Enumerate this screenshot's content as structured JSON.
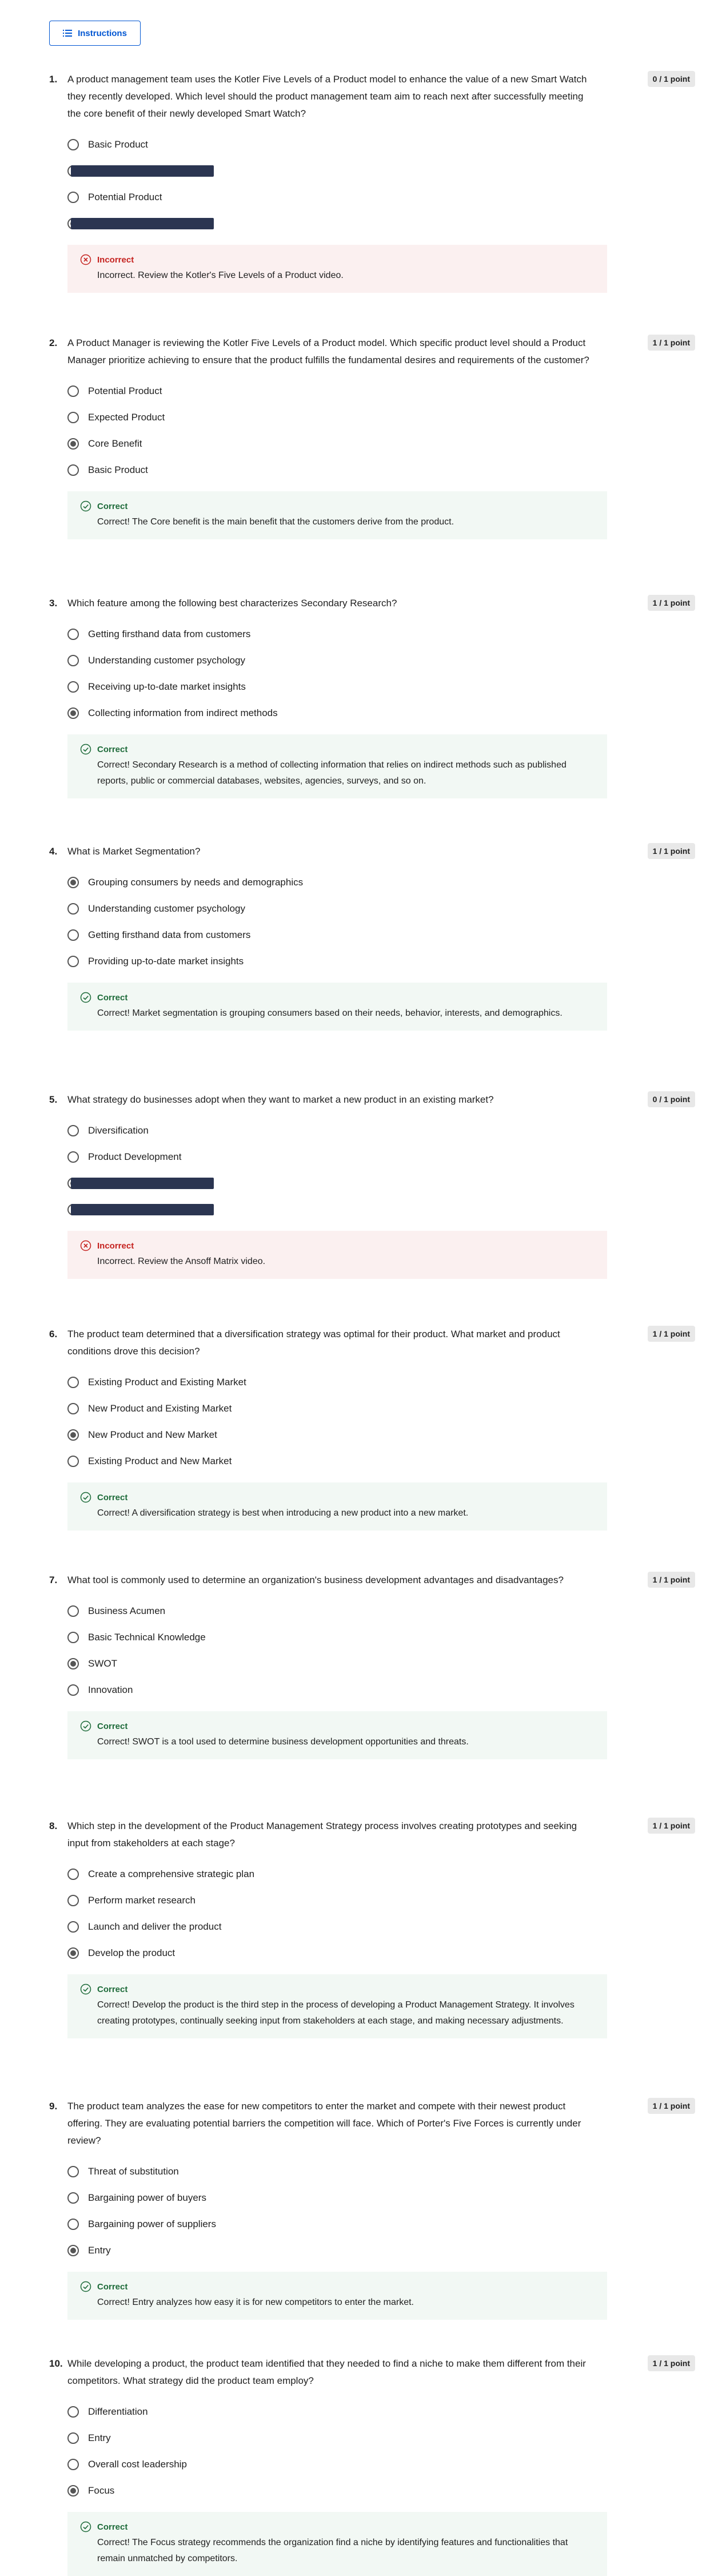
{
  "instructions_label": "Instructions",
  "colors": {
    "accent": "#0056d2",
    "correct": "#1e6b3a",
    "incorrect": "#c5221f"
  },
  "questions": [
    {
      "number": "1.",
      "text": "A product management team uses the Kotler Five Levels of a Product model to enhance the value of a new Smart Watch they recently developed. Which level should the product management team aim to reach next after successfully meeting the core benefit of their newly developed Smart Watch?",
      "score": "0 / 1 point",
      "options": [
        {
          "label": "Basic Product",
          "checked": false
        },
        {
          "label": "",
          "checked": false,
          "redacted": true
        },
        {
          "label": "Potential Product",
          "checked": false
        },
        {
          "label": "",
          "checked": true,
          "redacted": true
        }
      ],
      "feedback": {
        "status": "Incorrect",
        "text": "Incorrect. Review the Kotler's Five Levels of a Product video."
      }
    },
    {
      "number": "2.",
      "text": "A Product Manager is reviewing the Kotler Five Levels of a Product model. Which specific product level should a Product Manager prioritize achieving to ensure that the product fulfills the fundamental desires and requirements of the customer?",
      "score": "1 / 1 point",
      "options": [
        {
          "label": "Potential Product",
          "checked": false
        },
        {
          "label": "Expected Product",
          "checked": false
        },
        {
          "label": "Core Benefit",
          "checked": true
        },
        {
          "label": "Basic Product",
          "checked": false
        }
      ],
      "feedback": {
        "status": "Correct",
        "text": "Correct! The Core benefit is the main benefit that the customers derive from the product."
      }
    },
    {
      "number": "3.",
      "text": "Which feature among the following best characterizes Secondary Research?",
      "score": "1 / 1 point",
      "options": [
        {
          "label": "Getting firsthand data from customers",
          "checked": false
        },
        {
          "label": "Understanding customer psychology",
          "checked": false
        },
        {
          "label": "Receiving up-to-date market insights",
          "checked": false
        },
        {
          "label": "Collecting information from indirect methods",
          "checked": true
        }
      ],
      "feedback": {
        "status": "Correct",
        "text": "Correct! Secondary Research is a method of collecting information that relies on indirect methods such as published reports, public or commercial databases, websites, agencies, surveys, and so on."
      }
    },
    {
      "number": "4.",
      "text": "What is Market Segmentation?",
      "score": "1 / 1 point",
      "options": [
        {
          "label": "Grouping consumers by needs and demographics",
          "checked": true
        },
        {
          "label": "Understanding customer psychology",
          "checked": false
        },
        {
          "label": "Getting firsthand data from customers",
          "checked": false
        },
        {
          "label": "Providing up-to-date market insights",
          "checked": false
        }
      ],
      "feedback": {
        "status": "Correct",
        "text": "Correct! Market segmentation is grouping consumers based on their needs, behavior, interests, and demographics."
      }
    },
    {
      "number": "5.",
      "text": "What strategy do businesses adopt when they want to market a new product in an existing market?",
      "score": "0 / 1 point",
      "options": [
        {
          "label": "Diversification",
          "checked": false
        },
        {
          "label": "Product Development",
          "checked": false
        },
        {
          "label": "",
          "checked": true,
          "redacted": true
        },
        {
          "label": "",
          "checked": false,
          "redacted": true
        }
      ],
      "feedback": {
        "status": "Incorrect",
        "text": "Incorrect. Review the Ansoff Matrix video."
      }
    },
    {
      "number": "6.",
      "text": "The product team determined that a diversification strategy was optimal for their product. What market and product conditions drove this decision?",
      "score": "1 / 1 point",
      "options": [
        {
          "label": "Existing Product and Existing Market",
          "checked": false
        },
        {
          "label": "New Product and Existing Market",
          "checked": false
        },
        {
          "label": "New Product and New Market",
          "checked": true
        },
        {
          "label": "Existing Product and New Market",
          "checked": false
        }
      ],
      "feedback": {
        "status": "Correct",
        "text": "Correct! A diversification strategy is best when introducing a new product into a new market."
      }
    },
    {
      "number": "7.",
      "text": "What tool is commonly used to determine an organization's business development advantages and disadvantages?",
      "score": "1 / 1 point",
      "options": [
        {
          "label": "Business Acumen",
          "checked": false
        },
        {
          "label": "Basic Technical Knowledge",
          "checked": false
        },
        {
          "label": "SWOT",
          "checked": true
        },
        {
          "label": "Innovation",
          "checked": false
        }
      ],
      "feedback": {
        "status": "Correct",
        "text": "Correct! SWOT is a tool used to determine business development opportunities and threats."
      }
    },
    {
      "number": "8.",
      "text": "Which step in the development of the Product Management Strategy process involves creating prototypes and seeking input from stakeholders at each stage?",
      "score": "1 / 1 point",
      "options": [
        {
          "label": "Create a comprehensive strategic plan",
          "checked": false
        },
        {
          "label": "Perform market research",
          "checked": false
        },
        {
          "label": "Launch and deliver the product",
          "checked": false
        },
        {
          "label": "Develop the product",
          "checked": true
        }
      ],
      "feedback": {
        "status": "Correct",
        "text": "Correct! Develop the product is the third step in the process of developing a Product Management Strategy. It involves creating prototypes, continually seeking input from stakeholders at each stage, and making necessary adjustments."
      }
    },
    {
      "number": "9.",
      "text": "The product team analyzes the ease for new competitors to enter the market and compete with their newest product offering. They are evaluating potential barriers the competition will face. Which of Porter's Five Forces is currently under review?",
      "score": "1 / 1 point",
      "options": [
        {
          "label": "Threat of substitution",
          "checked": false
        },
        {
          "label": "Bargaining power of buyers",
          "checked": false
        },
        {
          "label": "Bargaining power of suppliers",
          "checked": false
        },
        {
          "label": "Entry",
          "checked": true
        }
      ],
      "feedback": {
        "status": "Correct",
        "text": "Correct! Entry analyzes how easy it is for new competitors to enter the market."
      }
    },
    {
      "number": "10.",
      "text": "While developing a product, the product team identified that they needed to find a niche to make them different from their competitors. What strategy did the product team employ?",
      "score": "1 / 1 point",
      "options": [
        {
          "label": "Differentiation",
          "checked": false
        },
        {
          "label": "Entry",
          "checked": false
        },
        {
          "label": "Overall cost leadership",
          "checked": false
        },
        {
          "label": "Focus",
          "checked": true
        }
      ],
      "feedback": {
        "status": "Correct",
        "text": "Correct! The Focus strategy recommends the organization find a niche by identifying features and functionalities that remain unmatched by competitors."
      }
    }
  ]
}
